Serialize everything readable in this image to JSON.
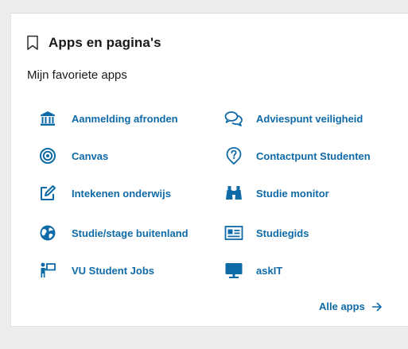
{
  "panel": {
    "title": "Apps en pagina's",
    "title_icon": "bookmark-icon",
    "section_label": "Mijn favoriete apps",
    "accent_color": "#0f6aa8",
    "apps_left": [
      {
        "label": "Aanmelding afronden",
        "icon": "institution-icon"
      },
      {
        "label": "Canvas",
        "icon": "target-icon"
      },
      {
        "label": "Intekenen onderwijs",
        "icon": "edit-icon"
      },
      {
        "label": "Studie/stage buitenland",
        "icon": "globe-icon"
      },
      {
        "label": "VU Student Jobs",
        "icon": "person-presenting-icon"
      }
    ],
    "apps_right": [
      {
        "label": "Adviespunt veiligheid",
        "icon": "chat-icon"
      },
      {
        "label": "Contactpunt Studenten",
        "icon": "question-icon"
      },
      {
        "label": "Studie monitor",
        "icon": "binoculars-icon"
      },
      {
        "label": "Studiegids",
        "icon": "id-card-icon"
      },
      {
        "label": "askIT",
        "icon": "monitor-icon"
      }
    ],
    "all_apps_label": "Alle apps",
    "all_apps_icon": "arrow-right-icon"
  }
}
